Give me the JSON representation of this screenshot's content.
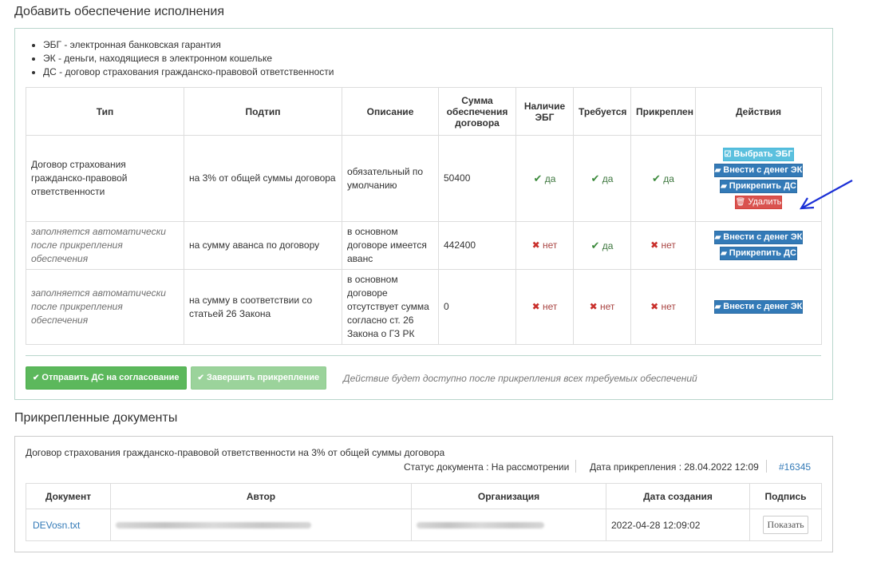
{
  "section1": {
    "title": "Добавить обеспечение исполнения",
    "legend": [
      "ЭБГ - электронная банковская гарантия",
      "ЭК - деньги, находящиеся в электронном кошельке",
      "ДС - договор страхования гражданско-правовой ответственности"
    ],
    "table": {
      "headers": {
        "type": "Тип",
        "subtype": "Подтип",
        "description": "Описание",
        "amount": "Сумма обеспечения договора",
        "has_ebg": "Наличие ЭБГ",
        "required": "Требуется",
        "attached": "Прикреплен",
        "actions": "Действия"
      },
      "rows": [
        {
          "type": "Договор страхования гражданско-правовой ответственности",
          "subtype": "на 3% от общей суммы договора",
          "description": "обязательный по умолчанию",
          "amount": "50400",
          "has_ebg": "да",
          "required": "да",
          "attached": "да"
        },
        {
          "type": "заполняется автоматически после прикрепления обеспечения",
          "subtype": "на сумму аванса по договору",
          "description": "в основном договоре имеется аванс",
          "amount": "442400",
          "has_ebg": "нет",
          "required": "да",
          "attached": "нет"
        },
        {
          "type": "заполняется автоматически после прикрепления обеспечения",
          "subtype": "на сумму в соответствии со статьей 26 Закона",
          "description": "в основном договоре отсутствует сумма согласно ст. 26 Закона о ГЗ РК",
          "amount": "0",
          "has_ebg": "нет",
          "required": "нет",
          "attached": "нет"
        }
      ],
      "buttons": {
        "choose_ebg": "Выбрать ЭБГ",
        "deposit_ek": "Внести с денег ЭК",
        "attach_ds": "Прикрепить ДС",
        "delete": "Удалить"
      }
    },
    "send_button": "Отправить ДС на согласование",
    "finish_button": "Завершить прикрепление",
    "hint": "Действие будет доступно после прикрепления всех требуемых обеспечений"
  },
  "section2": {
    "title": "Прикрепленные документы",
    "doc_title": "Договор страхования гражданско-правовой ответственности на 3% от общей суммы договора",
    "status": "Статус документа : На рассмотрении",
    "attach_date": "Дата прикрепления : 28.04.2022 12:09",
    "doc_id": "#16345",
    "table": {
      "headers": {
        "document": "Документ",
        "author": "Автор",
        "organization": "Организация",
        "created": "Дата создания",
        "signature": "Подпись"
      },
      "row": {
        "document": "DEVosn.txt",
        "created": "2022-04-28 12:09:02",
        "show_button": "Показать"
      }
    }
  },
  "colors": {
    "primary": "#337ab7",
    "info": "#5bc0de",
    "danger": "#d9534f",
    "success": "#5cb85c",
    "yes": "#3c763d",
    "no": "#a94442",
    "arrow": "#1a2fd6"
  }
}
